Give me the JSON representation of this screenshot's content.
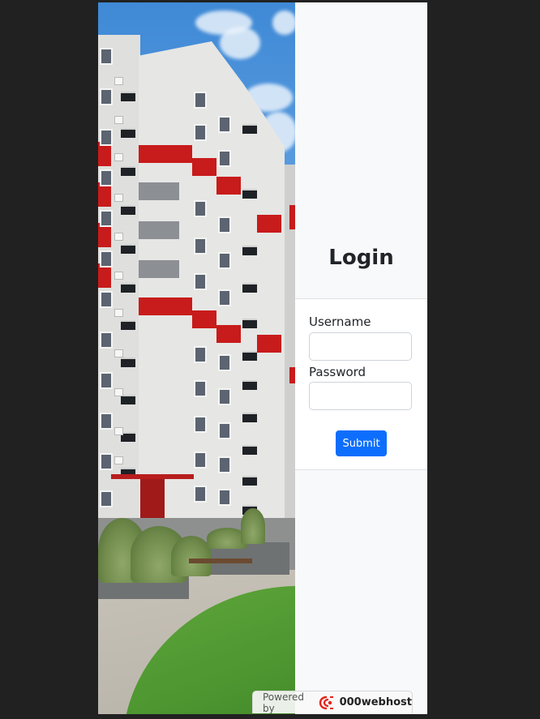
{
  "login": {
    "title": "Login",
    "username_label": "Username",
    "username_value": "",
    "password_label": "Password",
    "password_value": "",
    "submit_label": "Submit"
  },
  "badge": {
    "prefix": "Powered by",
    "brand": "000webhost",
    "logo_icon": "000webhost-logo-icon"
  },
  "colors": {
    "page_background": "#212121",
    "panel_background": "#f8f9fa",
    "submit_button": "#0d6efd",
    "facade_accent": "#c81b1b"
  }
}
